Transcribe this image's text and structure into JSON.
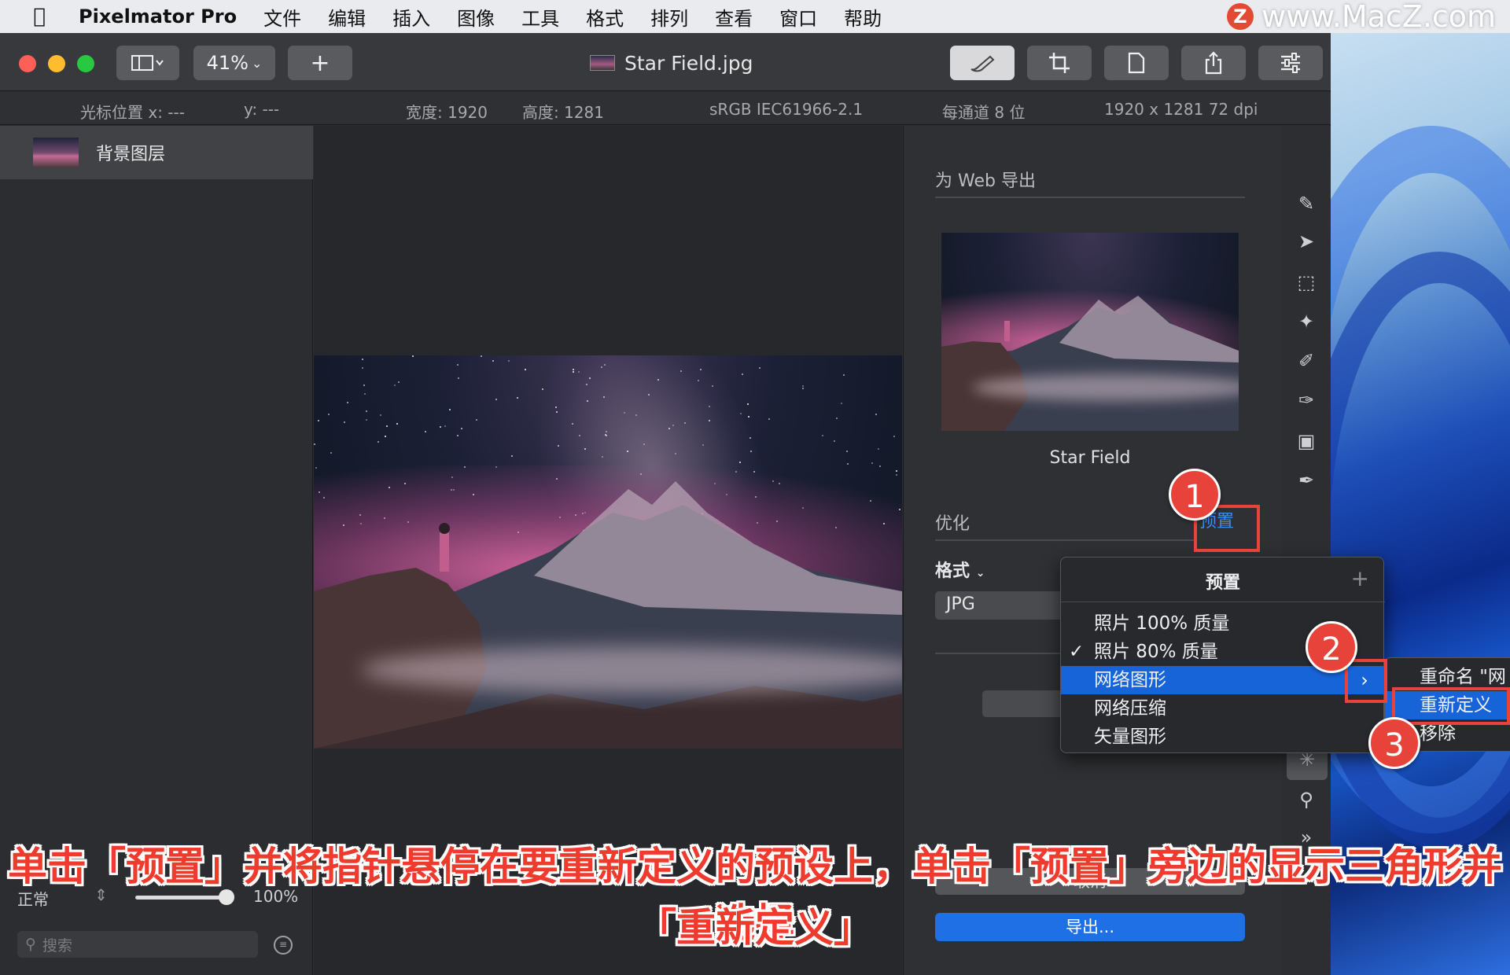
{
  "menubar": {
    "app_name": "Pixelmator Pro",
    "items": [
      "文件",
      "编辑",
      "插入",
      "图像",
      "工具",
      "格式",
      "排列",
      "查看",
      "窗口",
      "帮助"
    ]
  },
  "watermark": {
    "logo": "Z",
    "text": "www.MacZ.com"
  },
  "toolbar": {
    "zoom": "41%",
    "add_label": "+",
    "document_title": "Star Field.jpg"
  },
  "infobar": {
    "cursor_x": "光标位置 x: ---",
    "cursor_y": "y: ---",
    "width": "宽度: 1920",
    "height": "高度: 1281",
    "color_profile": "sRGB IEC61966-2.1",
    "bit_depth": "每通道 8 位",
    "dimensions": "1920 x 1281 72 dpi"
  },
  "layers": {
    "items": [
      {
        "name": "背景图层"
      }
    ],
    "blend_mode": "正常",
    "opacity": "100%",
    "opacity_value": 1.0,
    "search_placeholder": "搜索"
  },
  "export_panel": {
    "title": "为 Web 导出",
    "preview_name": "Star Field",
    "optimize_label": "优化",
    "preset_button": "预置",
    "format_label": "格式",
    "format_value": "JPG",
    "cancel_label": "取消",
    "export_label": "导出..."
  },
  "preset_menu": {
    "title": "预置",
    "add": "+",
    "items": [
      {
        "label": "照片 100% 质量",
        "checked": false
      },
      {
        "label": "照片 80% 质量",
        "checked": true
      },
      {
        "label": "网络图形",
        "checked": false,
        "highlighted": true
      },
      {
        "label": "网络压缩",
        "checked": false
      },
      {
        "label": "矢量图形",
        "checked": false
      }
    ],
    "check_mark": "✓",
    "submenu_arrow": "›"
  },
  "submenu": {
    "items": [
      "重命名 \"网",
      "重新定义",
      "移除"
    ]
  },
  "callouts": [
    "1",
    "2",
    "3"
  ],
  "caption": {
    "line1": "单击「预置」并将指针悬停在要重新定义的预设上，单击「预置」旁边的显示三角形并选择",
    "line2": "「重新定义」"
  },
  "colors": {
    "accent": "#1764d9",
    "callout_red": "#e8433a",
    "export_button": "#1f6fe5"
  }
}
